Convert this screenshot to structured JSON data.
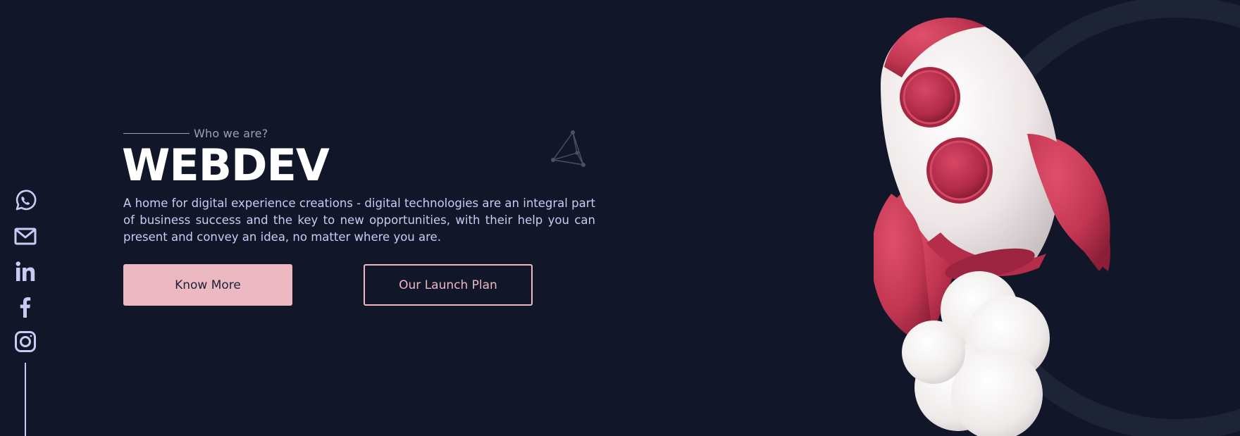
{
  "hero": {
    "eyebrow": "Who we are?",
    "title": "WEBDEV",
    "description": "A home for digital experience creations - digital technologies are an integral part of business success and the key to new opportunities, with their help you can present and convey an idea, no matter where you are.",
    "primary_button": "Know More",
    "secondary_button": "Our Launch Plan"
  },
  "social": [
    {
      "icon": "whatsapp-icon"
    },
    {
      "icon": "mail-icon"
    },
    {
      "icon": "linkedin-icon"
    },
    {
      "icon": "facebook-icon"
    },
    {
      "icon": "instagram-icon"
    }
  ],
  "colors": {
    "background": "#111729",
    "accent_pink": "#ecb9c2",
    "text_light": "#c8ccf5",
    "rocket_red": "#c23652",
    "rocket_white": "#f1ecec"
  }
}
